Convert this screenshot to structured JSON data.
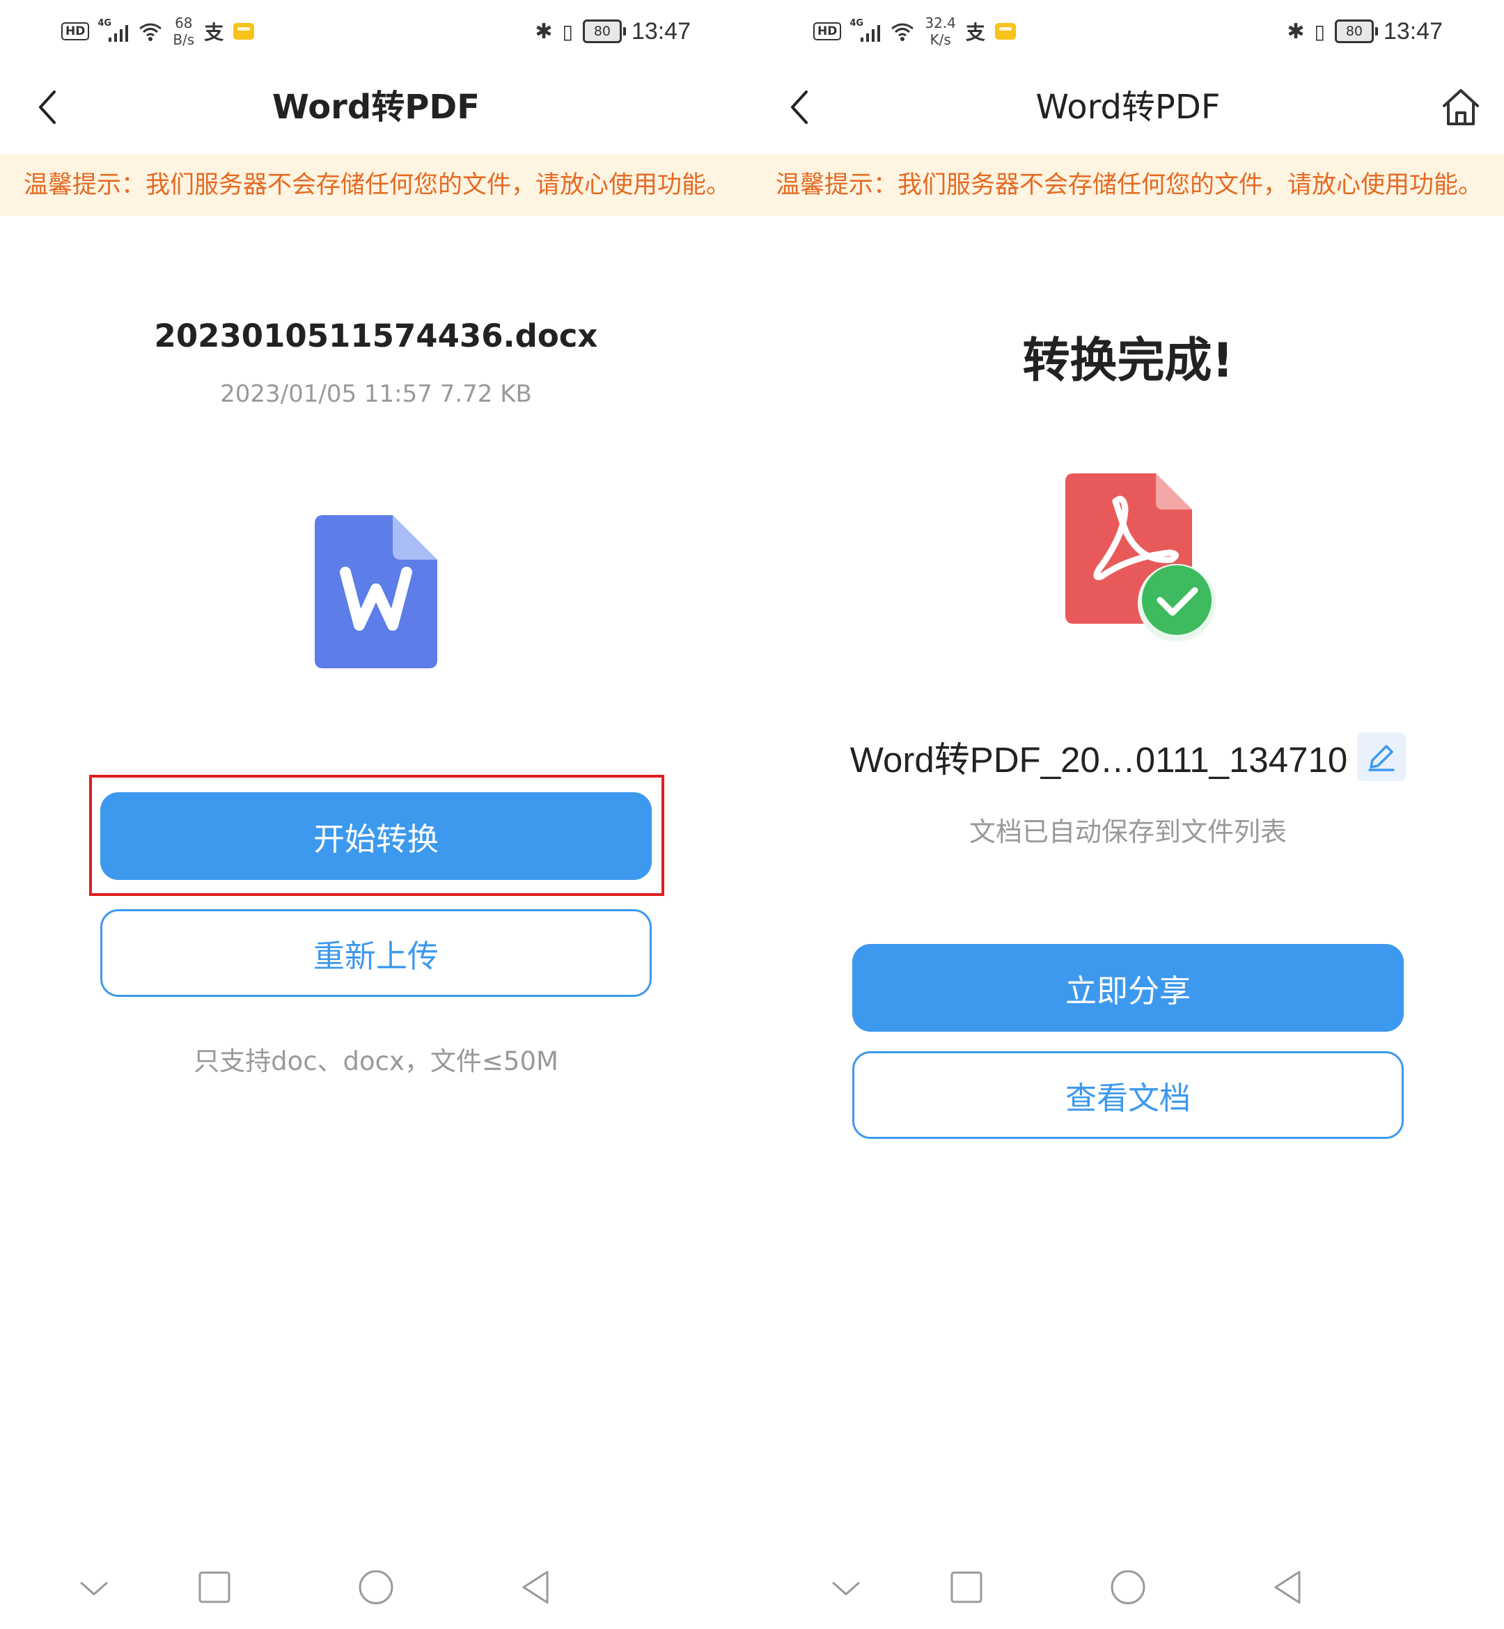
{
  "left": {
    "status": {
      "speed_value": "68",
      "speed_unit": "B/s",
      "net": "4G",
      "battery": "80",
      "time": "13:47"
    },
    "title": "Word转PDF",
    "notice": "温馨提示：我们服务器不会存储任何您的文件，请放心使用功能。",
    "file": {
      "name": "20230105115744​36.docx",
      "meta": "2023/01/05 11:57  7.72 KB"
    },
    "start_button": "开始转换",
    "reupload_button": "重新上传",
    "hint": "只支持doc、docx，文件≤50M"
  },
  "right": {
    "status": {
      "speed_value": "32.4",
      "speed_unit": "K/s",
      "net": "4G",
      "battery": "80",
      "time": "13:47"
    },
    "title": "Word转PDF",
    "notice": "温馨提示：我们服务器不会存储任何您的文件，请放心使用功能。",
    "done_title": "转换完成!",
    "output_name": "Word转PDF_20…0111_134710",
    "saved_note": "文档已自动保存到文件列表",
    "share_button": "立即分享",
    "view_button": "查看文档"
  },
  "colors": {
    "accent": "#3d99ee",
    "notice_bg": "#fdf4e2",
    "notice_text": "#e66a21",
    "highlight": "#e01e1e"
  },
  "icons": [
    "back-icon",
    "home-icon",
    "word-file-icon",
    "pdf-file-icon",
    "check-badge-icon",
    "edit-icon",
    "nav-collapse-icon",
    "nav-recents-icon",
    "nav-home-icon",
    "nav-back-icon"
  ]
}
